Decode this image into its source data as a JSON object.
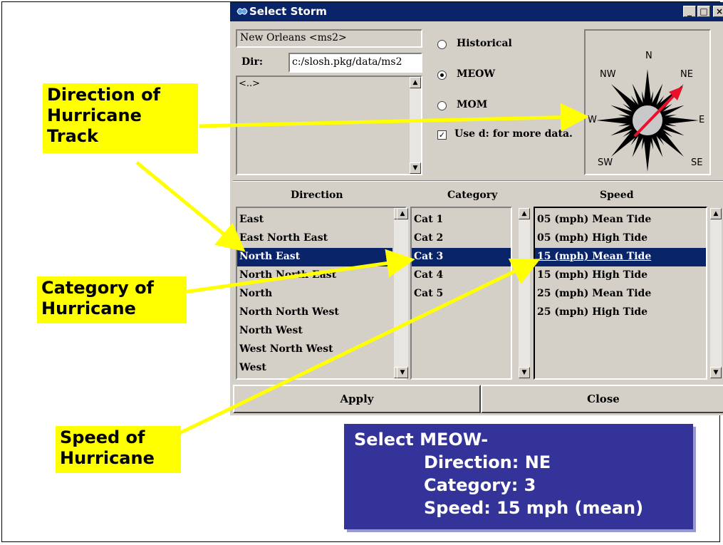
{
  "window": {
    "title": "Select Storm",
    "controls": {
      "minimize": "_",
      "maximize": "□",
      "close": "×"
    }
  },
  "basin": {
    "name": "New Orleans <ms2>",
    "dir_label": "Dir:",
    "dir_value": "c:/slosh.pkg/data/ms2",
    "list_items": [
      "<..>"
    ]
  },
  "storm_type": {
    "options": [
      {
        "label": "Historical",
        "selected": false
      },
      {
        "label": "MEOW",
        "selected": true
      },
      {
        "label": "MOM",
        "selected": false
      }
    ],
    "use_d_label": "Use d: for more data.",
    "use_d_checked": true
  },
  "compass": {
    "labels": {
      "n": "N",
      "ne": "NE",
      "e": "E",
      "se": "SE",
      "sw": "SW",
      "w": "W",
      "nw": "NW"
    },
    "track_direction": "NE",
    "arrow_color": "#e8102a"
  },
  "direction": {
    "header": "Direction",
    "items": [
      "East",
      "East North East",
      "North East",
      "North North East",
      "North",
      "North North West",
      "North West",
      "West North West",
      "West"
    ],
    "selected": "North East"
  },
  "category": {
    "header": "Category",
    "items": [
      "Cat 1",
      "Cat 2",
      "Cat 3",
      "Cat 4",
      "Cat 5"
    ],
    "selected": "Cat 3"
  },
  "speed": {
    "header": "Speed",
    "items": [
      "05 (mph) Mean Tide",
      "05 (mph) High Tide",
      "15 (mph) Mean Tide",
      "15 (mph) High Tide",
      "25 (mph) Mean Tide",
      "25 (mph) High Tide"
    ],
    "selected": "15 (mph) Mean Tide"
  },
  "buttons": {
    "apply": "Apply",
    "close": "Close"
  },
  "callouts": {
    "direction": [
      "Direction of",
      "Hurricane",
      "Track"
    ],
    "category": [
      "Category of",
      "Hurricane"
    ],
    "speed": [
      "Speed of",
      "Hurricane"
    ]
  },
  "summary": {
    "line1": "Select MEOW-",
    "line2": "Direction: NE",
    "line3": "Category: 3",
    "line4": "Speed: 15 mph (mean)"
  },
  "colors": {
    "selection": "#0a246a",
    "callout_bg": "#ffff00",
    "summary_bg": "#333399",
    "window_bg": "#d4d0c8"
  }
}
